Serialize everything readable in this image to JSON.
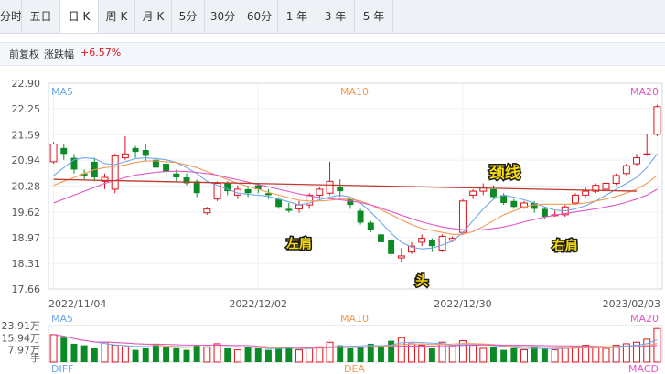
{
  "tabs": [
    {
      "label": "分时",
      "active": false
    },
    {
      "label": "五日",
      "active": false
    },
    {
      "label": "日 K",
      "active": true
    },
    {
      "label": "周 K",
      "active": false
    },
    {
      "label": "月 K",
      "active": false
    },
    {
      "label": "5分",
      "active": false
    },
    {
      "label": "30分",
      "active": false
    },
    {
      "label": "60分",
      "active": false
    },
    {
      "label": "1 年",
      "active": false
    },
    {
      "label": "3 年",
      "active": false
    },
    {
      "label": "5 年",
      "active": false
    }
  ],
  "info": {
    "adjust": "前复权",
    "change_label": "涨跌幅",
    "change_value": "+6.57%"
  },
  "colors": {
    "up": "#e0121c",
    "down": "#0c8a25",
    "ma5": "#6fa6e8",
    "ma10": "#f29a55",
    "ma20": "#e255c6",
    "neckline": "#c0392b"
  },
  "chart_data": {
    "type": "candlestick",
    "title": "",
    "legend": {
      "ma5": "MA5",
      "ma10": "MA10",
      "ma20": "MA20"
    },
    "y_ticks": [
      "22.90",
      "22.25",
      "21.59",
      "20.94",
      "20.28",
      "19.62",
      "18.97",
      "18.31",
      "17.66"
    ],
    "ylim": [
      17.66,
      22.9
    ],
    "x_ticks": [
      {
        "label": "2022/11/04",
        "index": 0
      },
      {
        "label": "2022/12/02",
        "index": 20
      },
      {
        "label": "2022/12/30",
        "index": 40
      },
      {
        "label": "2023/02/03",
        "index": 59
      }
    ],
    "candles": [
      [
        20.9,
        21.35,
        21.4,
        20.85
      ],
      [
        21.25,
        21.1,
        21.35,
        20.95
      ],
      [
        21.0,
        20.7,
        21.1,
        20.6
      ],
      [
        20.6,
        20.55,
        20.7,
        20.45
      ],
      [
        20.9,
        20.5,
        21.0,
        20.4
      ],
      [
        20.4,
        20.5,
        20.6,
        20.2
      ],
      [
        20.2,
        21.05,
        21.1,
        20.1
      ],
      [
        21.0,
        21.1,
        21.55,
        20.95
      ],
      [
        21.25,
        21.15,
        21.3,
        21.0
      ],
      [
        21.2,
        21.05,
        21.35,
        20.9
      ],
      [
        20.95,
        20.75,
        21.05,
        20.7
      ],
      [
        20.85,
        20.65,
        20.95,
        20.55
      ],
      [
        20.6,
        20.5,
        20.7,
        20.4
      ],
      [
        20.5,
        20.35,
        20.6,
        20.3
      ],
      [
        20.4,
        20.1,
        20.45,
        20.0
      ],
      [
        19.6,
        19.7,
        19.75,
        19.55
      ],
      [
        19.95,
        20.35,
        20.4,
        19.9
      ],
      [
        20.35,
        20.15,
        20.4,
        20.05
      ],
      [
        20.05,
        20.2,
        20.3,
        19.95
      ],
      [
        20.2,
        20.1,
        20.25,
        20.0
      ],
      [
        20.3,
        20.2,
        20.35,
        20.1
      ],
      [
        20.1,
        20.05,
        20.2,
        19.95
      ],
      [
        19.95,
        19.75,
        20.0,
        19.7
      ],
      [
        19.7,
        19.65,
        19.85,
        19.6
      ],
      [
        19.7,
        19.8,
        19.9,
        19.6
      ],
      [
        19.8,
        20.05,
        20.1,
        19.7
      ],
      [
        20.05,
        20.2,
        20.25,
        19.95
      ],
      [
        20.1,
        20.4,
        20.9,
        20.05
      ],
      [
        20.25,
        20.15,
        20.45,
        20.0
      ],
      [
        19.95,
        19.8,
        20.0,
        19.7
      ],
      [
        19.65,
        19.35,
        19.7,
        19.3
      ],
      [
        19.35,
        19.15,
        19.4,
        19.1
      ],
      [
        19.05,
        18.85,
        19.1,
        18.8
      ],
      [
        18.9,
        18.55,
        18.95,
        18.5
      ],
      [
        18.45,
        18.5,
        18.7,
        18.35
      ],
      [
        18.6,
        18.75,
        18.85,
        18.55
      ],
      [
        18.85,
        18.95,
        19.05,
        18.75
      ],
      [
        18.9,
        18.75,
        18.95,
        18.6
      ],
      [
        18.65,
        19.0,
        19.05,
        18.6
      ],
      [
        18.9,
        18.95,
        19.0,
        18.85
      ],
      [
        19.1,
        19.9,
        19.95,
        19.05
      ],
      [
        20.05,
        20.15,
        20.2,
        19.95
      ],
      [
        20.15,
        20.25,
        20.35,
        20.05
      ],
      [
        20.2,
        20.0,
        20.3,
        19.95
      ],
      [
        20.05,
        19.85,
        20.1,
        19.8
      ],
      [
        19.9,
        19.75,
        19.95,
        19.7
      ],
      [
        19.75,
        19.85,
        19.9,
        19.7
      ],
      [
        19.85,
        19.7,
        19.9,
        19.6
      ],
      [
        19.7,
        19.5,
        19.75,
        19.45
      ],
      [
        19.55,
        19.55,
        19.65,
        19.5
      ],
      [
        19.55,
        19.75,
        19.8,
        19.5
      ],
      [
        19.85,
        20.05,
        20.1,
        19.8
      ],
      [
        20.05,
        20.15,
        20.25,
        20.0
      ],
      [
        20.15,
        20.3,
        20.35,
        20.1
      ],
      [
        20.2,
        20.35,
        20.45,
        20.2
      ],
      [
        20.35,
        20.55,
        20.6,
        20.3
      ],
      [
        20.6,
        20.8,
        20.85,
        20.55
      ],
      [
        20.85,
        21.0,
        21.1,
        20.8
      ],
      [
        21.1,
        21.1,
        21.6,
        21.05
      ],
      [
        21.6,
        22.3,
        22.35,
        21.55
      ]
    ],
    "ma5": [
      20.55,
      20.75,
      20.95,
      21.0,
      20.98,
      20.85,
      20.83,
      20.9,
      20.98,
      21.0,
      20.98,
      20.95,
      20.88,
      20.75,
      20.6,
      20.4,
      20.3,
      20.2,
      20.1,
      20.07,
      20.05,
      20.02,
      19.95,
      19.88,
      19.8,
      19.85,
      19.93,
      20.0,
      20.05,
      20.0,
      19.85,
      19.62,
      19.35,
      19.08,
      18.85,
      18.72,
      18.68,
      18.7,
      18.78,
      18.88,
      19.1,
      19.4,
      19.7,
      19.95,
      20.05,
      20.0,
      19.93,
      19.85,
      19.75,
      19.67,
      19.65,
      19.7,
      19.78,
      19.9,
      20.05,
      20.2,
      20.35,
      20.5,
      20.75,
      21.1
    ],
    "ma10": [
      20.3,
      20.4,
      20.5,
      20.6,
      20.7,
      20.75,
      20.78,
      20.82,
      20.88,
      20.92,
      20.92,
      20.9,
      20.88,
      20.82,
      20.75,
      20.65,
      20.55,
      20.45,
      20.35,
      20.27,
      20.2,
      20.12,
      20.05,
      19.98,
      19.92,
      19.9,
      19.9,
      19.92,
      19.95,
      19.95,
      19.9,
      19.8,
      19.68,
      19.55,
      19.42,
      19.3,
      19.2,
      19.15,
      19.1,
      19.05,
      19.05,
      19.12,
      19.25,
      19.4,
      19.55,
      19.65,
      19.75,
      19.8,
      19.82,
      19.82,
      19.82,
      19.82,
      19.85,
      19.9,
      19.95,
      20.02,
      20.1,
      20.2,
      20.35,
      20.55
    ],
    "ma20": [
      19.85,
      19.95,
      20.05,
      20.15,
      20.25,
      20.35,
      20.42,
      20.5,
      20.56,
      20.6,
      20.63,
      20.65,
      20.66,
      20.65,
      20.63,
      20.6,
      20.56,
      20.5,
      20.44,
      20.38,
      20.32,
      20.26,
      20.2,
      20.14,
      20.08,
      20.03,
      19.99,
      19.96,
      19.93,
      19.9,
      19.86,
      19.8,
      19.72,
      19.63,
      19.54,
      19.45,
      19.37,
      19.3,
      19.24,
      19.2,
      19.17,
      19.16,
      19.17,
      19.2,
      19.24,
      19.3,
      19.37,
      19.43,
      19.49,
      19.54,
      19.58,
      19.62,
      19.66,
      19.7,
      19.75,
      19.8,
      19.87,
      19.95,
      20.05,
      20.2
    ],
    "neckline": {
      "label": "颈线",
      "from": {
        "index": 0,
        "value": 20.45
      },
      "to": {
        "index": 57,
        "value": 20.15
      }
    },
    "annotations": [
      {
        "label": "左肩",
        "index": 24,
        "value": 18.7
      },
      {
        "label": "头",
        "index": 36,
        "value": 17.75
      },
      {
        "label": "右肩",
        "index": 50,
        "value": 18.65
      }
    ],
    "volume": {
      "y_ticks": [
        "23.91万",
        "15.94万",
        "7.97万"
      ],
      "unit": "手",
      "ylim": [
        0,
        23.91
      ],
      "legend": {
        "ma5": "MA5",
        "ma10": "MA10",
        "ma20": "MA20"
      },
      "values": [
        18,
        16,
        12,
        11,
        9,
        13,
        11,
        10,
        8,
        9,
        12,
        10,
        9,
        8,
        11,
        10,
        12,
        9,
        8,
        10,
        9,
        8,
        9,
        10,
        8,
        9,
        10,
        13,
        11,
        9,
        10,
        12,
        11,
        14,
        16,
        12,
        11,
        9,
        13,
        10,
        14,
        11,
        9,
        10,
        8,
        9,
        8,
        10,
        9,
        8,
        9,
        10,
        11,
        10,
        9,
        11,
        12,
        13,
        15,
        22
      ]
    },
    "macd": {
      "legend": {
        "diff": "DIFF",
        "dea": "DEA",
        "macd": "MACD"
      }
    }
  }
}
